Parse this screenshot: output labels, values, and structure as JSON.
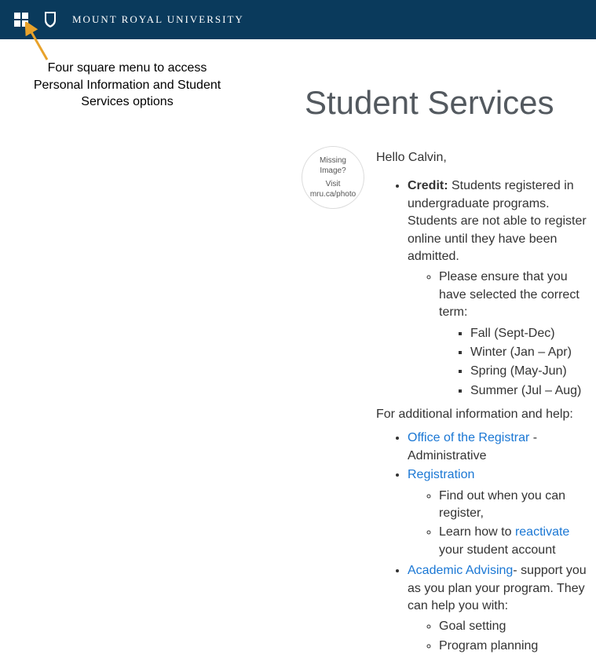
{
  "header": {
    "university_name": "MOUNT ROYAL UNIVERSITY"
  },
  "annotation": {
    "text": "Four square menu to access Personal Information and Student Services options"
  },
  "page": {
    "title": "Student Services"
  },
  "avatar": {
    "line1": "Missing Image?",
    "line2": "Visit mru.ca/photo"
  },
  "content": {
    "greeting": "Hello Calvin,",
    "credit_label": "Credit:",
    "credit_text": " Students registered in undergraduate programs. Students are not able to register online until they have been admitted.",
    "credit_note": "Please ensure that you have selected the correct term:",
    "terms": [
      "Fall (Sept-Dec)",
      "Winter (Jan – Apr)",
      "Spring (May-Jun)",
      "Summer (Jul – Aug)"
    ],
    "more_info": "For additional information and help:",
    "links": {
      "registrar": "Office of the Registrar",
      "registrar_tail": " - Administrative",
      "registration": "Registration",
      "reg_sub1": "Find out when you can register,",
      "reg_sub2_pre": "Learn how to ",
      "reg_sub2_link": "reactivate",
      "reg_sub2_post": " your student account",
      "advising": "Academic Advising",
      "advising_tail": "- support you as you plan your program. They can help you with:",
      "adv_sub1": "Goal setting",
      "adv_sub2": "Program planning"
    }
  }
}
